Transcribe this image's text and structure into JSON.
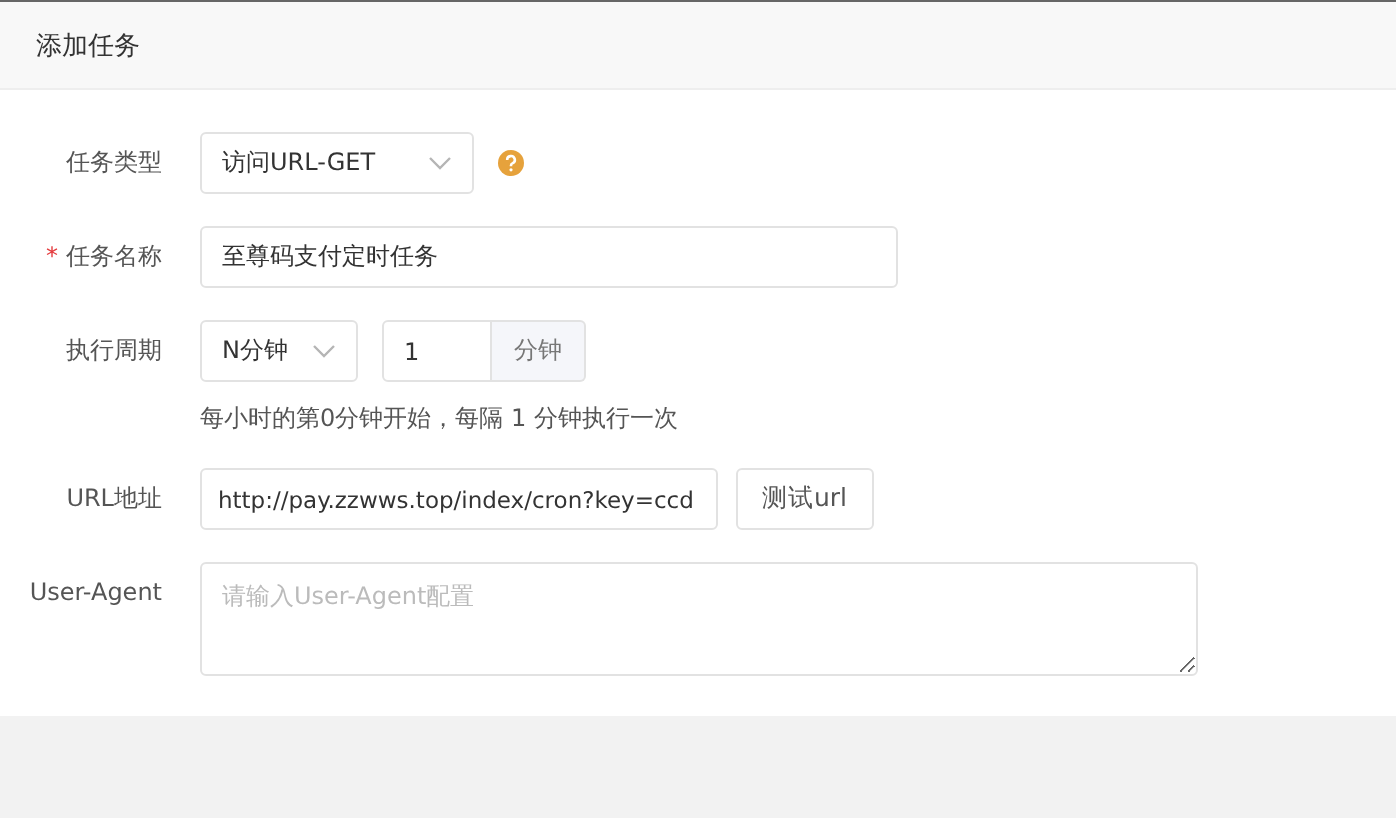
{
  "panel": {
    "title": "添加任务"
  },
  "fields": [
    {
      "kind": "select",
      "label": "任务类型",
      "value": "访问URL-GET"
    },
    {
      "kind": "text",
      "label": "任务名称",
      "mark": "*",
      "value": "至尊码支付定时任务"
    },
    {
      "kind": "period",
      "label": "执行周期",
      "value": "N分钟",
      "number": "1",
      "unit": "分钟",
      "hint": "每小时的第0分钟开始，每隔 1 分钟执行一次"
    },
    {
      "kind": "url",
      "label": "URL地址",
      "value": "http://pay.zzwws.top/index/cron?key=ccd",
      "button": "测试url"
    },
    {
      "kind": "textarea",
      "label": "User-Agent",
      "placeholder": "请输入User-Agent配置"
    }
  ]
}
